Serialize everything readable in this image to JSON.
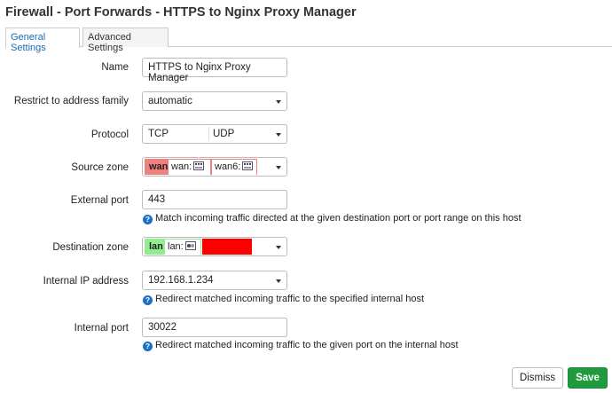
{
  "page": {
    "title": "Firewall - Port Forwards - HTTPS to Nginx Proxy Manager"
  },
  "tabs": [
    {
      "label": "General Settings",
      "active": true
    },
    {
      "label": "Advanced Settings",
      "active": false
    }
  ],
  "form": {
    "name": {
      "label": "Name",
      "value": "HTTPS to Nginx Proxy Manager"
    },
    "address_family": {
      "label": "Restrict to address family",
      "value": "automatic"
    },
    "protocol": {
      "label": "Protocol",
      "values": [
        "TCP",
        "UDP"
      ]
    },
    "source_zone": {
      "label": "Source zone",
      "zone": "wan",
      "zone_color": "#f08080",
      "interfaces": [
        "wan:",
        "wan6:"
      ]
    },
    "external_port": {
      "label": "External port",
      "value": "443",
      "help": "Match incoming traffic directed at the given destination port or port range on this host"
    },
    "destination_zone": {
      "label": "Destination zone",
      "zone": "lan",
      "zone_color": "#90ee90",
      "interfaces": [
        "lan:"
      ],
      "redacted_color": "#ff0000"
    },
    "internal_ip": {
      "label": "Internal IP address",
      "value": "192.168.1.234",
      "help": "Redirect matched incoming traffic to the specified internal host"
    },
    "internal_port": {
      "label": "Internal port",
      "value": "30022",
      "help": "Redirect matched incoming traffic to the given port on the internal host"
    }
  },
  "help_icon": "question-circle-icon",
  "interface_icon": "network-ports-icon",
  "buttons": {
    "dismiss": "Dismiss",
    "save": "Save"
  },
  "colors": {
    "save": "#1f9b3e",
    "tab_active": "#1a6bb3",
    "help_icon": "#1d6fc4"
  }
}
